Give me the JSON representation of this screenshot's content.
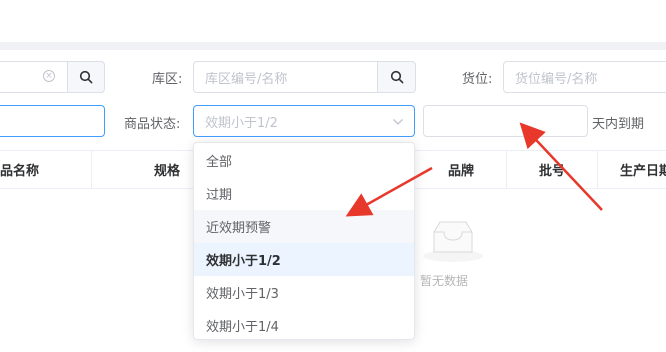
{
  "filters": {
    "search1_placeholder": "",
    "warehouse_label": "库区:",
    "warehouse_placeholder": "库区编号/名称",
    "location_label": "货位:",
    "location_placeholder": "货位编号/名称",
    "status_label": "商品状态:",
    "status_selected": "效期小于1/2",
    "days_value": "",
    "days_suffix": "天内到期"
  },
  "table": {
    "columns": [
      "品名称",
      "规格",
      "品牌",
      "批号",
      "生产日期"
    ]
  },
  "empty_text": "暂无数据",
  "dropdown": {
    "options": [
      "全部",
      "过期",
      "近效期预警",
      "效期小于1/2",
      "效期小于1/3",
      "效期小于1/4"
    ],
    "hovered_index": 2,
    "selected_index": 3
  },
  "colors": {
    "focus_border": "#409eff",
    "arrow": "#e8382c",
    "selected_bg": "#ecf5ff"
  }
}
